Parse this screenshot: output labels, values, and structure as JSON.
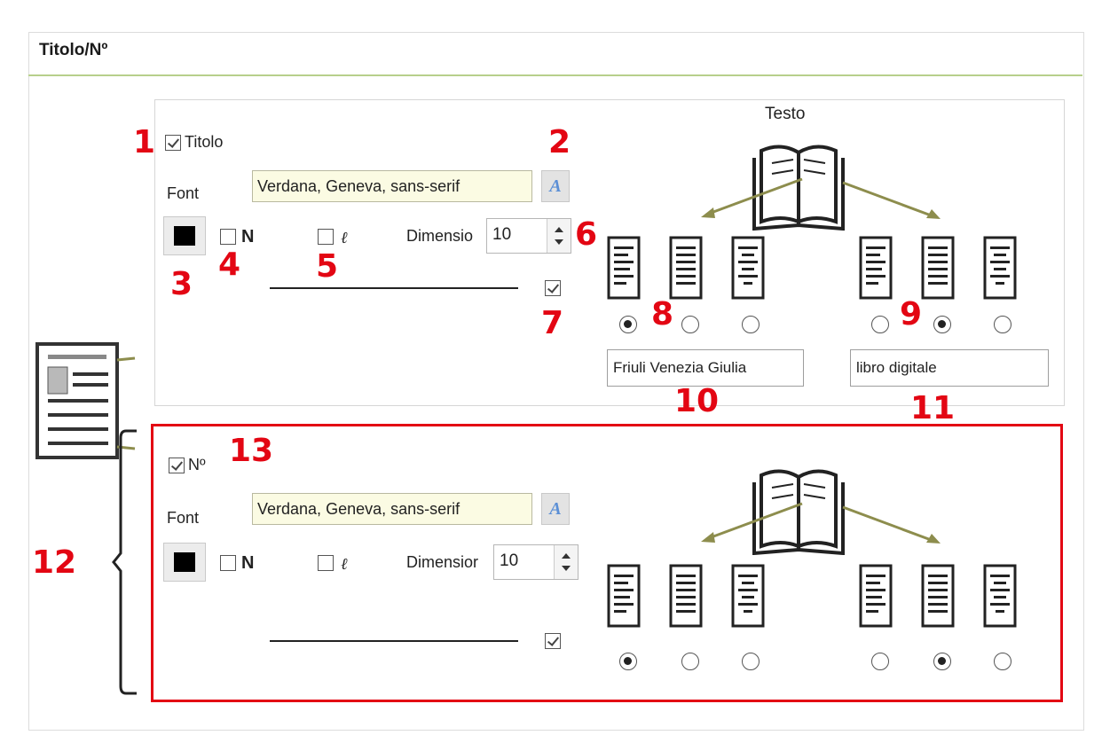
{
  "section_title": "Titolo/Nº",
  "titolo_group": {
    "checkbox_label": "Titolo",
    "checkbox_checked": true,
    "font_label": "Font",
    "font_value": "Verdana, Geneva, sans-serif",
    "font_button": "A",
    "color": "#000000",
    "bold_label": "N",
    "italic_label": "ℓ",
    "size_label": "Dimensio",
    "size_value": "10",
    "underline_checked": true,
    "testo_label": "Testo",
    "left_align_selected": 0,
    "right_align_selected": 1,
    "left_text_value": "Friuli Venezia Giulia",
    "right_text_value": "libro digitale"
  },
  "numero_group": {
    "checkbox_label": "Nº",
    "checkbox_checked": true,
    "font_label": "Font",
    "font_value": "Verdana, Geneva, sans-serif",
    "font_button": "A",
    "color": "#000000",
    "bold_label": "N",
    "italic_label": "ℓ",
    "size_label": "Dimensior",
    "size_value": "10",
    "underline_checked": true,
    "left_align_selected": 0,
    "right_align_selected": 1
  },
  "annotations": [
    "1",
    "2",
    "3",
    "4",
    "5",
    "6",
    "7",
    "8",
    "9",
    "10",
    "11",
    "12",
    "13"
  ],
  "colors": {
    "annotation_red": "#e30613",
    "title_underline": "#b7cf8b",
    "arrow": "#8d8d4d",
    "font_field_bg": "#fbfbe3"
  }
}
